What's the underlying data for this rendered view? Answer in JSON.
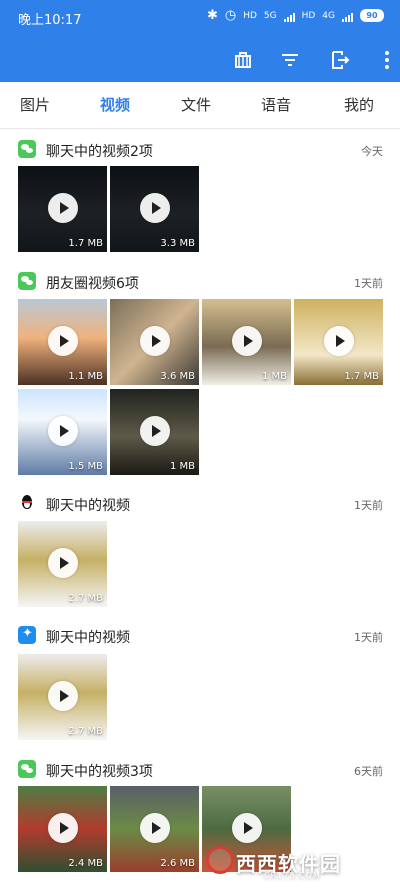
{
  "status": {
    "time": "晚上10:17",
    "network_labels": [
      "HD",
      "5G",
      "HD",
      "4G"
    ],
    "battery": "90"
  },
  "toolbar": {
    "icons": [
      "cleanup-icon",
      "filter-icon",
      "export-icon",
      "more-icon"
    ]
  },
  "tabs": [
    "图片",
    "视频",
    "文件",
    "语音",
    "我的"
  ],
  "sections": [
    {
      "title": "聊天中的视频2项",
      "date": "今天",
      "icon": "wechat-icon",
      "items": [
        "1.7 MB",
        "3.3 MB"
      ]
    },
    {
      "title": "朋友圈视频6项",
      "date": "1天前",
      "icon": "wechat-icon",
      "items": [
        "1.1 MB",
        "3.6 MB",
        "1 MB",
        "1.7 MB",
        "1.5 MB",
        "1 MB"
      ]
    },
    {
      "title": "聊天中的视频",
      "date": "1天前",
      "icon": "qq-icon",
      "items": [
        "2.7 MB"
      ]
    },
    {
      "title": "聊天中的视频",
      "date": "1天前",
      "icon": "bluestar-icon",
      "items": [
        "2.7 MB"
      ]
    },
    {
      "title": "聊天中的视频3项",
      "date": "6天前",
      "icon": "wechat-icon",
      "items": [
        "2.4 MB",
        "2.6 MB",
        ""
      ]
    }
  ],
  "watermark": {
    "text": "西西软件园",
    "sub": "CR173.COM"
  },
  "colors": {
    "primary": "#2f80e8",
    "wechat": "#4cc75a"
  }
}
